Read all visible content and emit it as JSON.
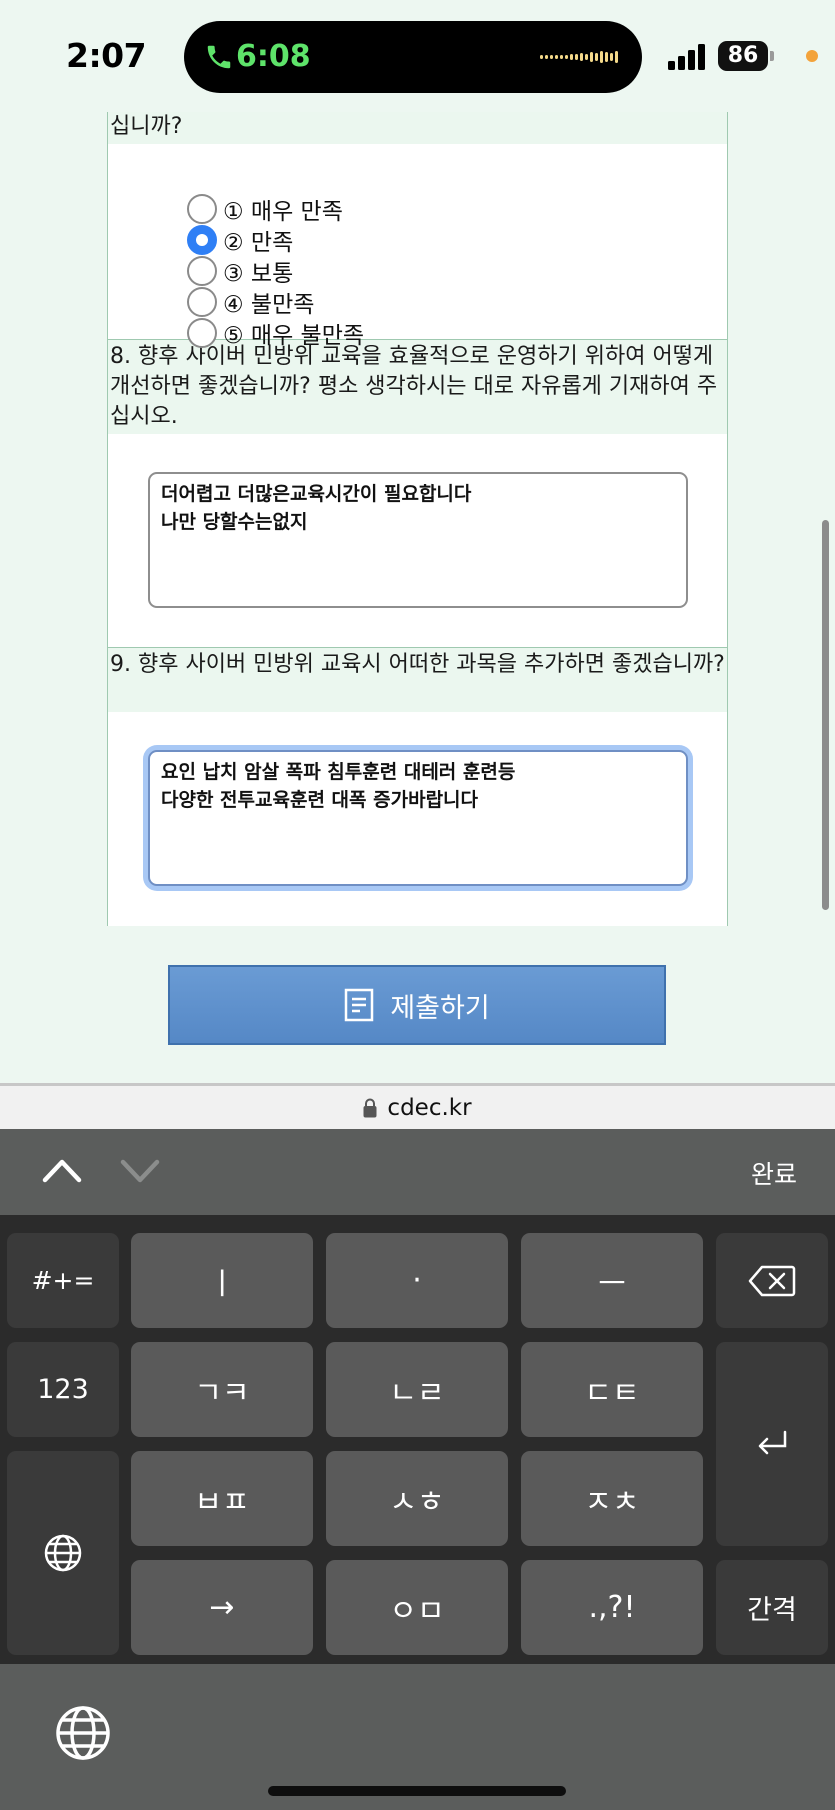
{
  "status": {
    "time": "2:07",
    "call_timer": "6:08",
    "battery": "86"
  },
  "survey": {
    "q7_tail": "십니까?",
    "options": [
      {
        "label": "① 매우 만족",
        "checked": false
      },
      {
        "label": "② 만족",
        "checked": true
      },
      {
        "label": "③ 보통",
        "checked": false
      },
      {
        "label": "④ 불만족",
        "checked": false
      },
      {
        "label": "⑤ 매우 불만족",
        "checked": false
      }
    ],
    "q8": "8. 향후 사이버 민방위 교육을 효율적으로 운영하기 위하여 어떻게 개선하면 좋겠습니까? 평소 생각하시는 대로 자유롭게 기재하여 주십시오.",
    "a8": "더어렵고 더많은교육시간이 필요합니다\n나만 당할수는없지",
    "q9": "9. 향후 사이버 민방위 교육시 어떠한 과목을 추가하면 좋겠습니까?",
    "a9": "요인 납치 암살 폭파 침투훈련 대테러 훈련등\n다양한 전투교육훈련 대폭 증가바랍니다"
  },
  "submit_label": "제출하기",
  "url": "cdec.kr",
  "keyboard": {
    "done": "완료",
    "symbols_key": "#+=",
    "numbers_key": "123",
    "space_key": "간격",
    "row1": [
      "ㅣ",
      "·",
      "ㅡ"
    ],
    "row2": [
      "ㄱㅋ",
      "ㄴㄹ",
      "ㄷㅌ"
    ],
    "row3": [
      "ㅂㅍ",
      "ㅅㅎ",
      "ㅈㅊ"
    ],
    "row4": [
      "→",
      "ㅇㅁ",
      ".,?!"
    ]
  }
}
